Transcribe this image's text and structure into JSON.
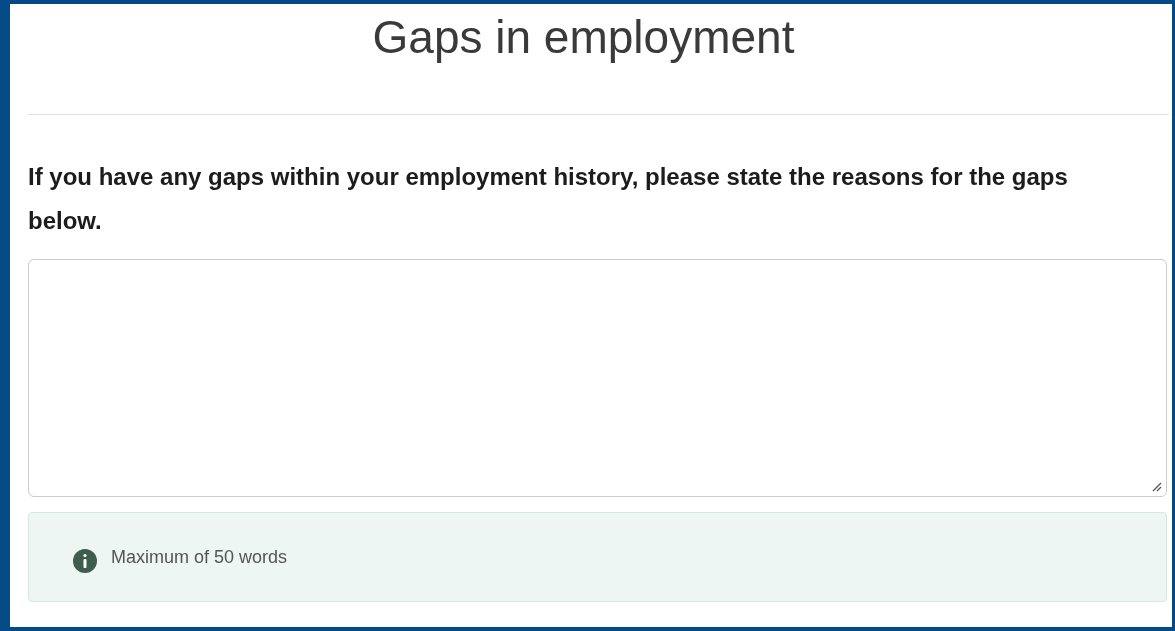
{
  "title": "Gaps in employment",
  "question": "If you have any gaps within your employment history, please state the reasons for the gaps below.",
  "hint": {
    "text": "Maximum of 50 words"
  }
}
